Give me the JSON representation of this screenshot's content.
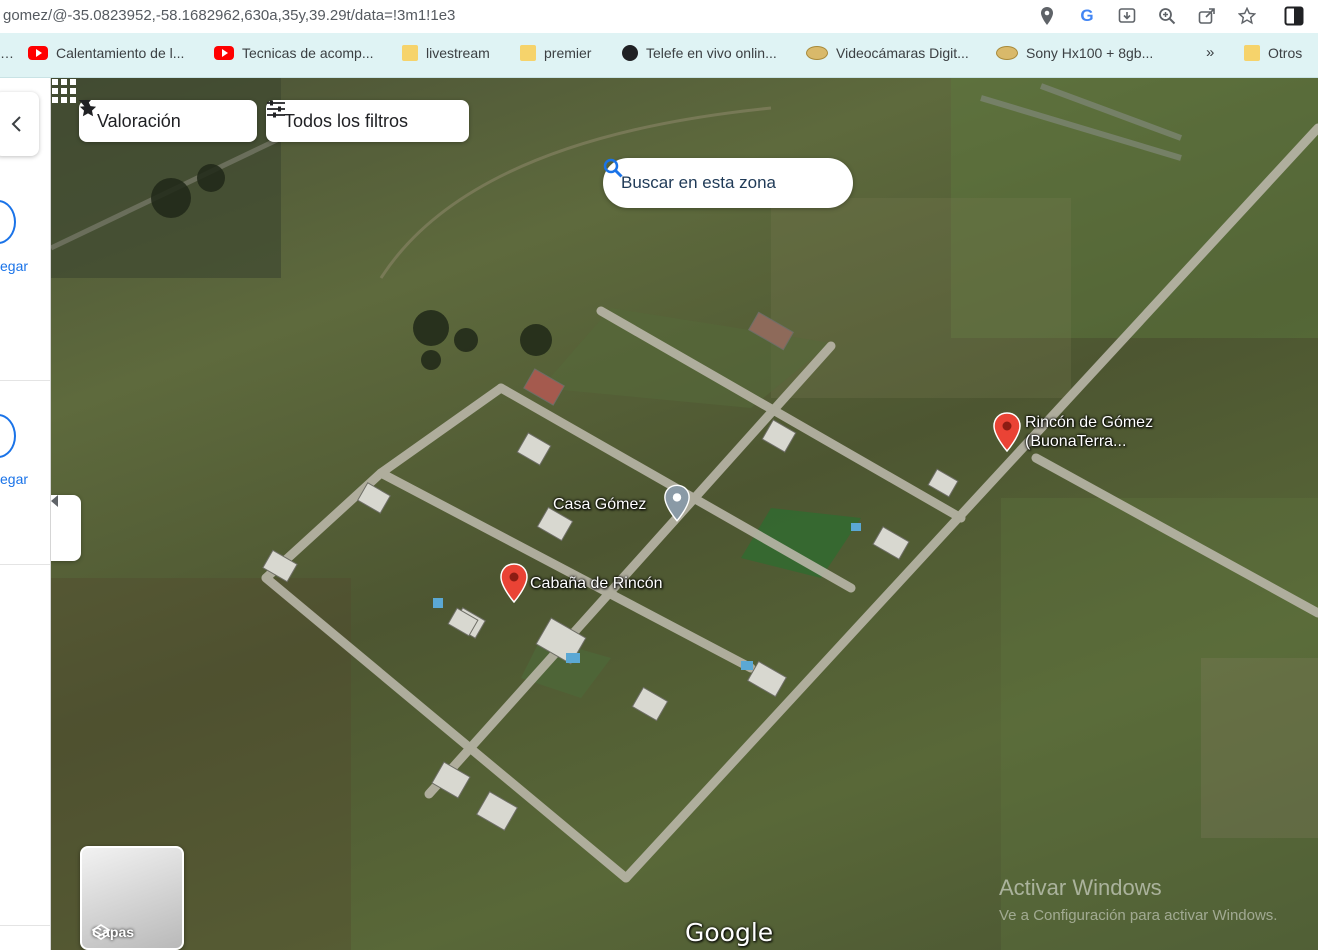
{
  "browser": {
    "url": "gomez/@-35.0823952,-58.1682962,630a,35y,39.29t/data=!3m1!1e3",
    "toolbar_icons": [
      "location-icon",
      "google-translate-icon",
      "install-icon",
      "zoom-icon",
      "share-icon",
      "bookmark-star-icon",
      "side-panel-icon"
    ],
    "bookmarks": [
      {
        "label": "Calentamiento de l...",
        "icon": "youtube-icon"
      },
      {
        "label": "Tecnicas de acomp...",
        "icon": "youtube-icon"
      },
      {
        "label": "livestream",
        "icon": "folder-icon"
      },
      {
        "label": "premier",
        "icon": "folder-icon"
      },
      {
        "label": "Telefe en vivo onlin...",
        "icon": "globe-icon"
      },
      {
        "label": "Videocámaras Digit...",
        "icon": "dish-icon"
      },
      {
        "label": "Sony Hx100 + 8gb...",
        "icon": "dish-icon"
      }
    ],
    "bookmarks_more": "»",
    "other_bookmarks": "Otros"
  },
  "left_panel": {
    "labels": [
      "egar",
      "egar"
    ]
  },
  "map": {
    "filters": {
      "rating_label": "Valoración",
      "all_filters_label": "Todos los filtros"
    },
    "search_area_label": "Buscar en esta zona",
    "places": [
      {
        "name": "Rincón de Gómez",
        "name_line2": "(BuonaTerra...",
        "pin": "red"
      },
      {
        "name": "Casa Gómez",
        "pin": "gray"
      },
      {
        "name": "Cabaña de Rincón",
        "pin": "red"
      }
    ],
    "layers_label": "Capas",
    "google_logo": "Google",
    "watermark": {
      "title": "Activar Windows",
      "subtitle": "Ve a Configuración para activar Windows."
    },
    "colors": {
      "red_pin": "#ea4335",
      "gray_pin": "#8a9aa6",
      "road": "#b9b6a8",
      "accent_blue": "#1a73e8"
    }
  }
}
